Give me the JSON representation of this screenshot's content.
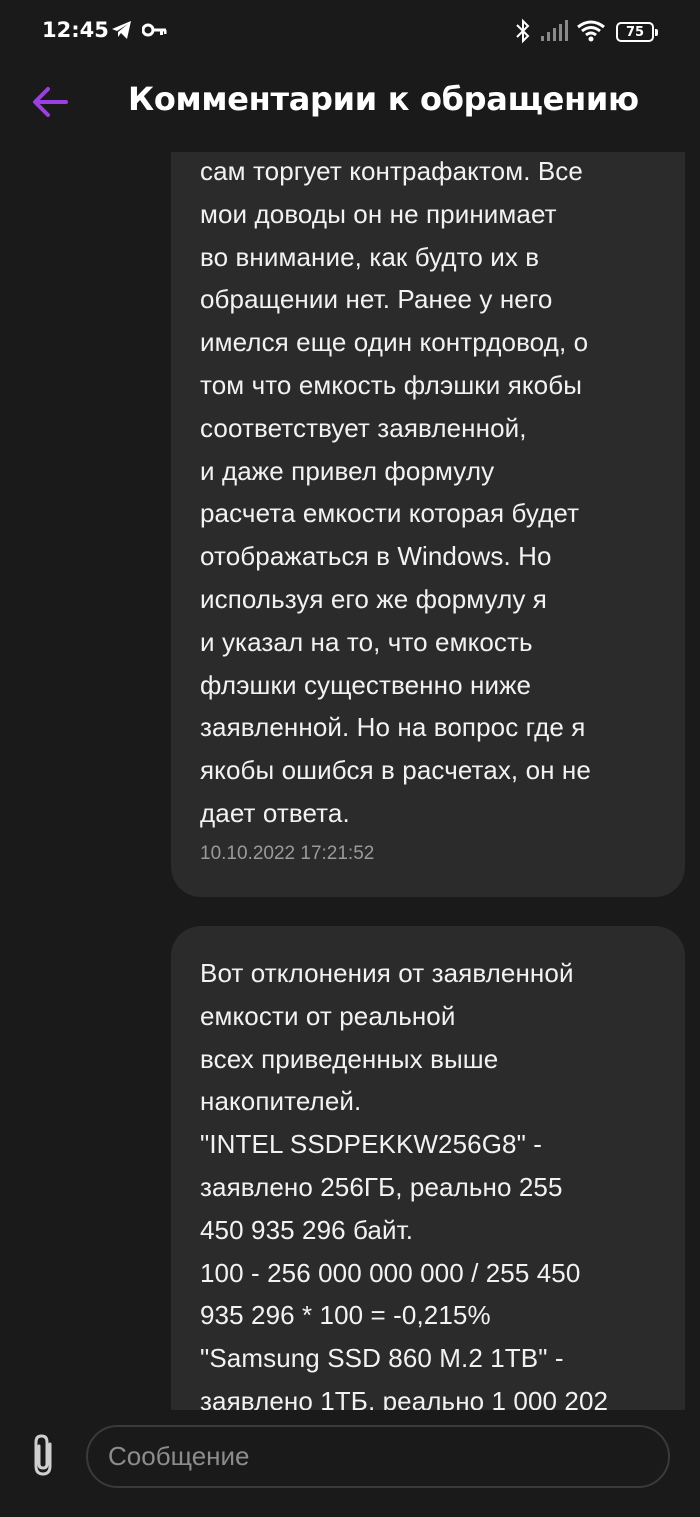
{
  "status_bar": {
    "time": "12:45",
    "battery": "75",
    "left_icons": [
      "telegram-icon",
      "key-icon"
    ],
    "right_icons": [
      "bluetooth-icon",
      "signal-icon",
      "wifi-icon",
      "battery-icon"
    ]
  },
  "header": {
    "title": "Комментарии к обращению",
    "back_icon": "arrow-left-icon",
    "accent_color": "#9b3fe0"
  },
  "messages": [
    {
      "text": "сам торгует контрафактом. Все\nмои доводы он не принимает\nво внимание, как будто их в\nобращении нет. Ранее у него\nимелся еще один контрдовод, о\nтом что емкость флэшки якобы\nсоответствует заявленной,\nи даже привел формулу\nрасчета емкости которая будет\nотображаться в Windows. Но\nиспользуя его же формулу я\nи указал на то, что емкость\nфлэшки существенно ниже\nзаявленной. Но на вопрос где я\nякобы ошибся в расчетах, он не\nдает ответа.",
      "timestamp": "10.10.2022 17:21:52"
    },
    {
      "text": "Вот отклонения от заявленной\nемкости от реальной\nвсех приведенных выше\nнакопителей.\n\"INTEL SSDPEKKW256G8\" -\nзаявлено 256ГБ, реально 255\n450 935 296 байт.\n100 - 256 000 000 000 / 255 450\n935 296 * 100 = -0,215%\n\"Samsung SSD 860 M.2 1TB\" -\nзаявлено 1ТБ, реально 1 000 202",
      "timestamp": ""
    }
  ],
  "input": {
    "placeholder": "Сообщение",
    "value": "",
    "attach_icon": "paperclip-icon"
  },
  "colors": {
    "background": "#1a1a1a",
    "bubble": "#2b2b2b",
    "accent": "#9b3fe0"
  }
}
